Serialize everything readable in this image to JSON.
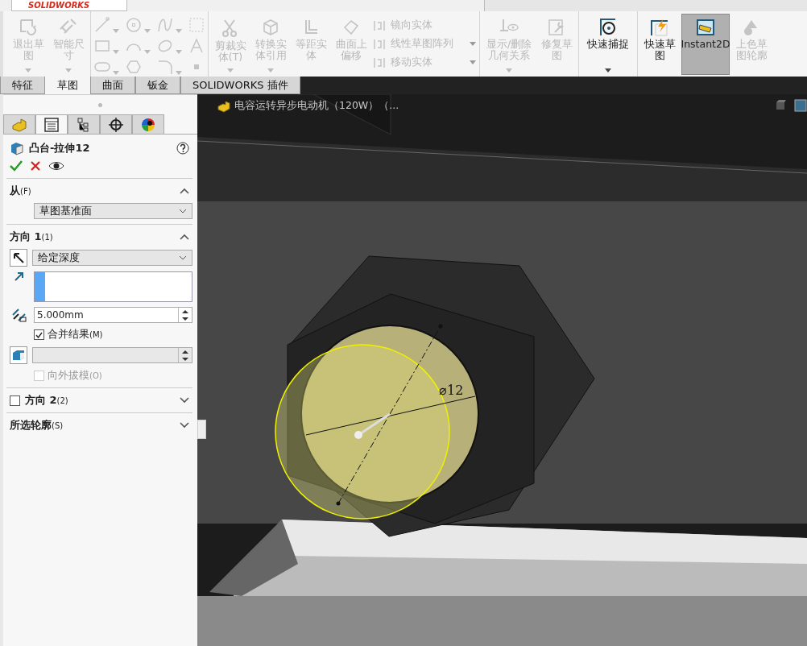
{
  "app_logo": "SOLIDWORKS",
  "toolbar": {
    "large_buttons": [
      {
        "label": "退出草图",
        "disabled": true,
        "dropdown": true
      },
      {
        "label": "智能尺寸",
        "disabled": true,
        "dropdown": true
      }
    ],
    "edit_buttons": [
      {
        "label": "剪裁实体(T)",
        "disabled": true,
        "dropdown": true
      },
      {
        "label": "转换实体引用",
        "disabled": true,
        "dropdown": true
      },
      {
        "label": "等距实体",
        "disabled": true,
        "dropdown": false
      },
      {
        "label": "曲面上偏移",
        "disabled": true,
        "dropdown": false
      }
    ],
    "list_items": [
      {
        "label": "镜向实体",
        "disabled": true,
        "dropdown": false
      },
      {
        "label": "线性草图阵列",
        "disabled": true,
        "dropdown": true
      },
      {
        "label": "移动实体",
        "disabled": true,
        "dropdown": true
      }
    ],
    "relation_buttons": [
      {
        "label": "显示/删除几何关系",
        "disabled": true,
        "dropdown": true
      },
      {
        "label": "修复草图",
        "disabled": true,
        "dropdown": false
      }
    ],
    "snap_buttons": [
      {
        "label": "快速捕捉",
        "disabled": false,
        "dropdown": true
      }
    ],
    "mode_buttons": [
      {
        "label": "快速草图",
        "disabled": false,
        "selected": false
      },
      {
        "label": "Instant2D",
        "disabled": false,
        "selected": true
      },
      {
        "label": "上色草图轮廓",
        "disabled": true,
        "selected": false
      }
    ]
  },
  "tabs": [
    {
      "label": "特征",
      "selected": false
    },
    {
      "label": "草图",
      "selected": true
    },
    {
      "label": "曲面",
      "selected": false
    },
    {
      "label": "钣金",
      "selected": false
    },
    {
      "label": "SOLIDWORKS 插件",
      "selected": false
    }
  ],
  "panel_tabs": [
    {
      "kind": "feature",
      "selected": false
    },
    {
      "kind": "property",
      "selected": true
    },
    {
      "kind": "config",
      "selected": false
    },
    {
      "kind": "dimxpert",
      "selected": false
    },
    {
      "kind": "display",
      "selected": false
    }
  ],
  "property_manager": {
    "title": "凸台-拉伸12",
    "sections": [
      {
        "kind": "from",
        "label": "从",
        "shortcut": "(F)",
        "expanded": true,
        "start": "草图基准面"
      },
      {
        "kind": "direction",
        "label": "方向 1",
        "shortcut": "(1)",
        "expanded": true,
        "end_condition": "给定深度",
        "depth": "5.000mm",
        "merge": {
          "label": "合并结果",
          "shortcut": "(M)",
          "checked": true
        },
        "draft_outward": {
          "label": "向外拔模",
          "shortcut": "(O)",
          "checked": false,
          "disabled": true
        }
      },
      {
        "kind": "toggle",
        "label": "方向 2",
        "shortcut": "(2)",
        "checked": false,
        "expanded": false
      },
      {
        "kind": "plain",
        "label": "所选轮廓",
        "shortcut": "(S)",
        "expanded": false
      }
    ]
  },
  "viewport": {
    "document_title": "电容运转异步电动机（120W）（...",
    "dimension": "⌀12"
  }
}
